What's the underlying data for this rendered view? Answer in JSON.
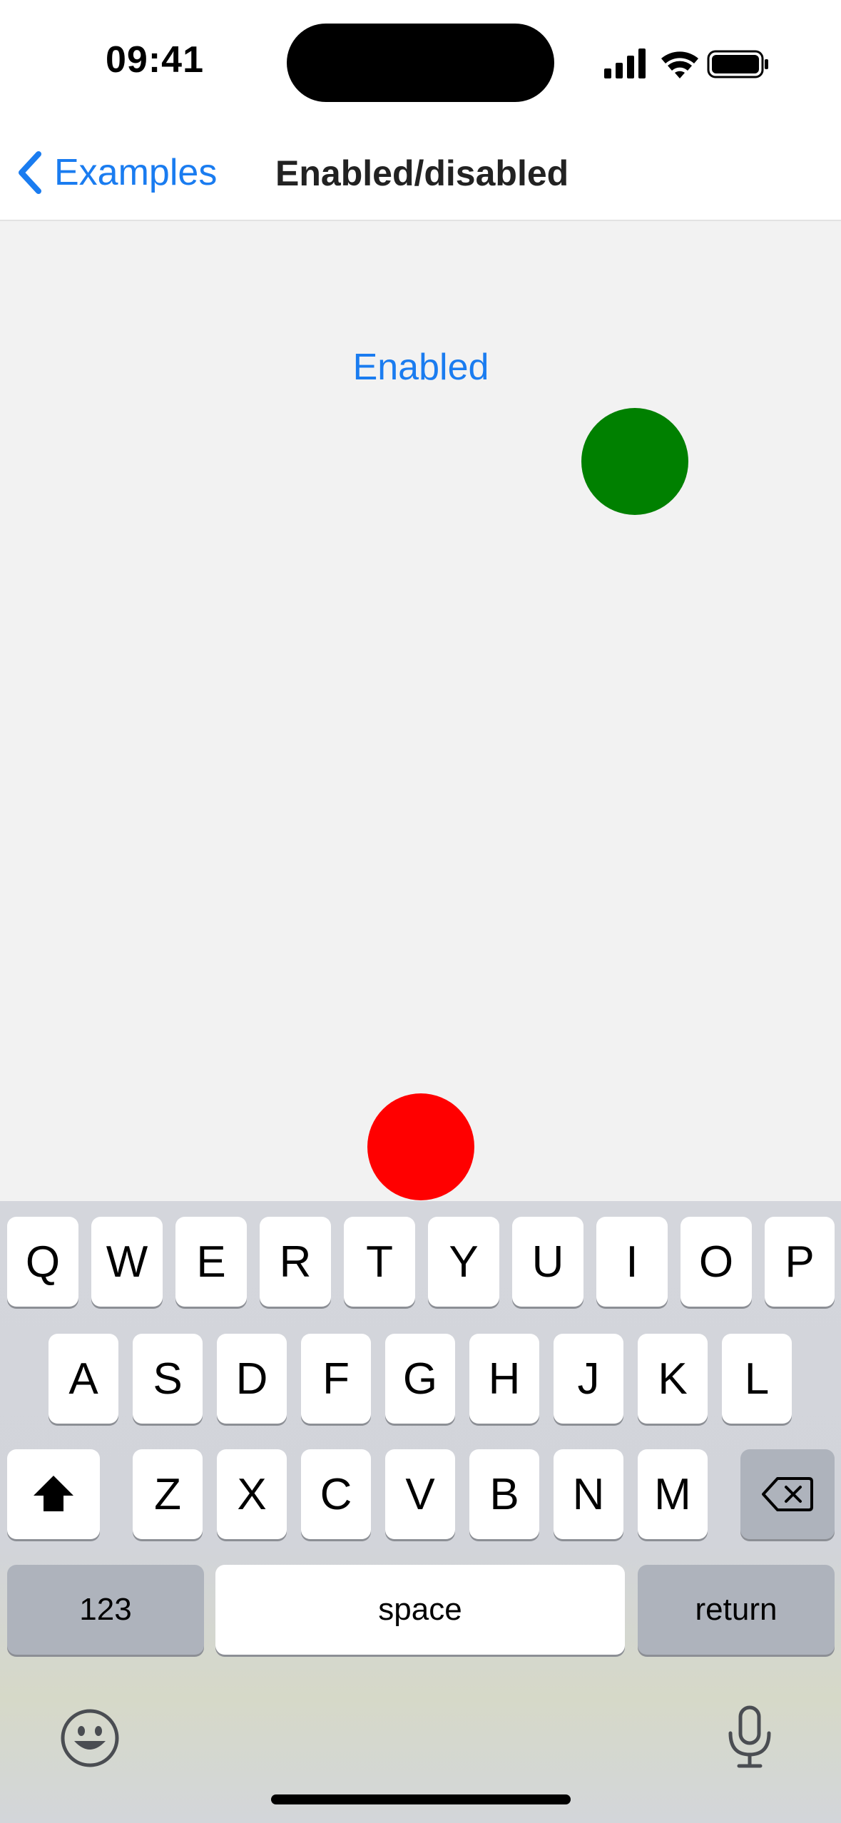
{
  "status_bar": {
    "time": "09:41"
  },
  "nav": {
    "back_label": "Examples",
    "title": "Enabled/disabled"
  },
  "content": {
    "enabled_button_label": "Enabled",
    "green_circle_color": "#008000",
    "red_circle_color": "#ff0000"
  },
  "keyboard": {
    "row1": [
      "Q",
      "W",
      "E",
      "R",
      "T",
      "Y",
      "U",
      "I",
      "O",
      "P"
    ],
    "row2": [
      "A",
      "S",
      "D",
      "F",
      "G",
      "H",
      "J",
      "K",
      "L"
    ],
    "row3": [
      "Z",
      "X",
      "C",
      "V",
      "B",
      "N",
      "M"
    ],
    "numbers_label": "123",
    "space_label": "space",
    "return_label": "return",
    "icons": [
      "shift-icon",
      "backspace-icon",
      "emoji-icon",
      "microphone-icon"
    ]
  },
  "colors": {
    "accent": "#1a7cf0",
    "key_background": "#ffffff",
    "dark_key_background": "#aeb3bc"
  }
}
